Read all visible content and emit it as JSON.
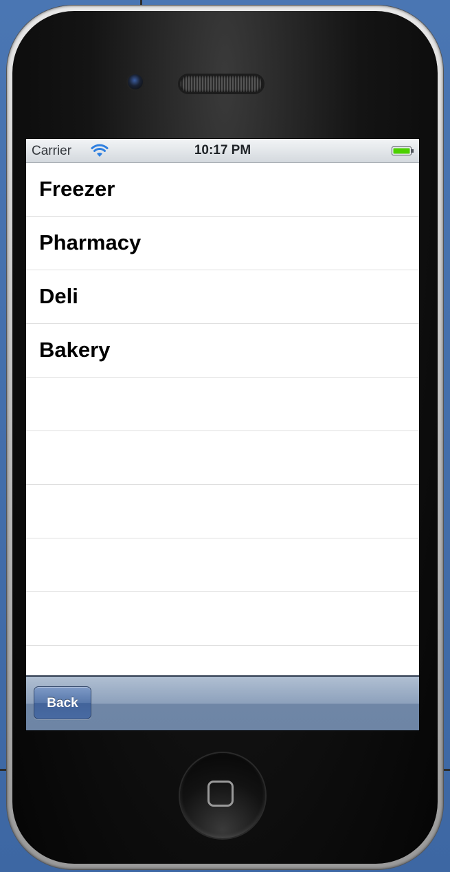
{
  "status_bar": {
    "carrier": "Carrier",
    "time": "10:17 PM",
    "wifi_icon": "wifi-icon",
    "battery_icon": "battery-icon",
    "battery_color": "#4cd000"
  },
  "list": {
    "rows": [
      {
        "label": "Freezer"
      },
      {
        "label": "Pharmacy"
      },
      {
        "label": "Deli"
      },
      {
        "label": "Bakery"
      },
      {
        "label": ""
      },
      {
        "label": ""
      },
      {
        "label": ""
      },
      {
        "label": ""
      },
      {
        "label": ""
      },
      {
        "label": ""
      }
    ]
  },
  "toolbar": {
    "back_label": "Back"
  },
  "device": {
    "home_button_icon": "home-square-icon",
    "backdrop_color": "#3f6aa8"
  }
}
